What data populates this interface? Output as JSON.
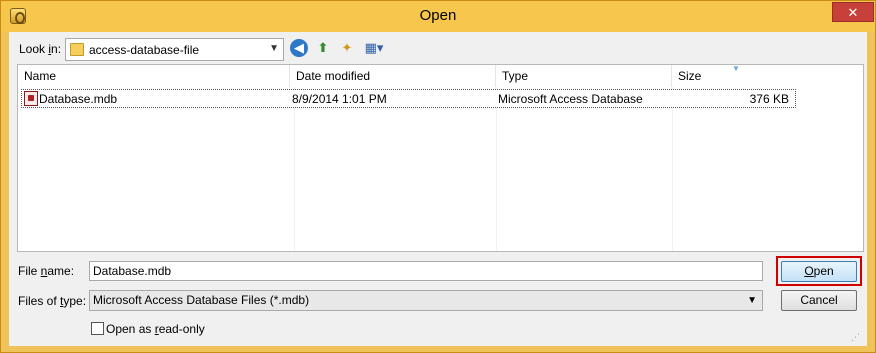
{
  "window": {
    "title": "Open",
    "close_label": "✕"
  },
  "toolbar": {
    "look_in_label_prefix": "Look ",
    "look_in_label_underlined": "i",
    "look_in_label_suffix": "n:",
    "look_in_value": "access-database-file",
    "icons": [
      "back-icon",
      "up-one-level-icon",
      "new-folder-icon",
      "views-menu-icon"
    ]
  },
  "file_list": {
    "columns": [
      "Name",
      "Date modified",
      "Type",
      "Size"
    ],
    "rows": [
      {
        "name": "Database.mdb",
        "date_modified": "8/9/2014 1:01 PM",
        "type": "Microsoft Access Database",
        "size": "376 KB"
      }
    ]
  },
  "form": {
    "file_name_label_prefix": "File ",
    "file_name_label_underlined": "n",
    "file_name_label_suffix": "ame:",
    "file_name_value": "Database.mdb",
    "files_of_type_label_prefix": "Files of ",
    "files_of_type_label_underlined": "t",
    "files_of_type_label_suffix": "ype:",
    "files_of_type_value": "Microsoft Access Database Files (*.mdb)",
    "read_only_label_prefix": "Open as ",
    "read_only_label_underlined": "r",
    "read_only_label_suffix": "ead-only",
    "read_only_checked": false
  },
  "buttons": {
    "open_prefix": "",
    "open_underlined": "O",
    "open_suffix": "pen",
    "cancel": "Cancel"
  },
  "colors": {
    "title_bar": "#f7c64c",
    "close_button": "#c7403a",
    "highlight": "#d00000"
  }
}
